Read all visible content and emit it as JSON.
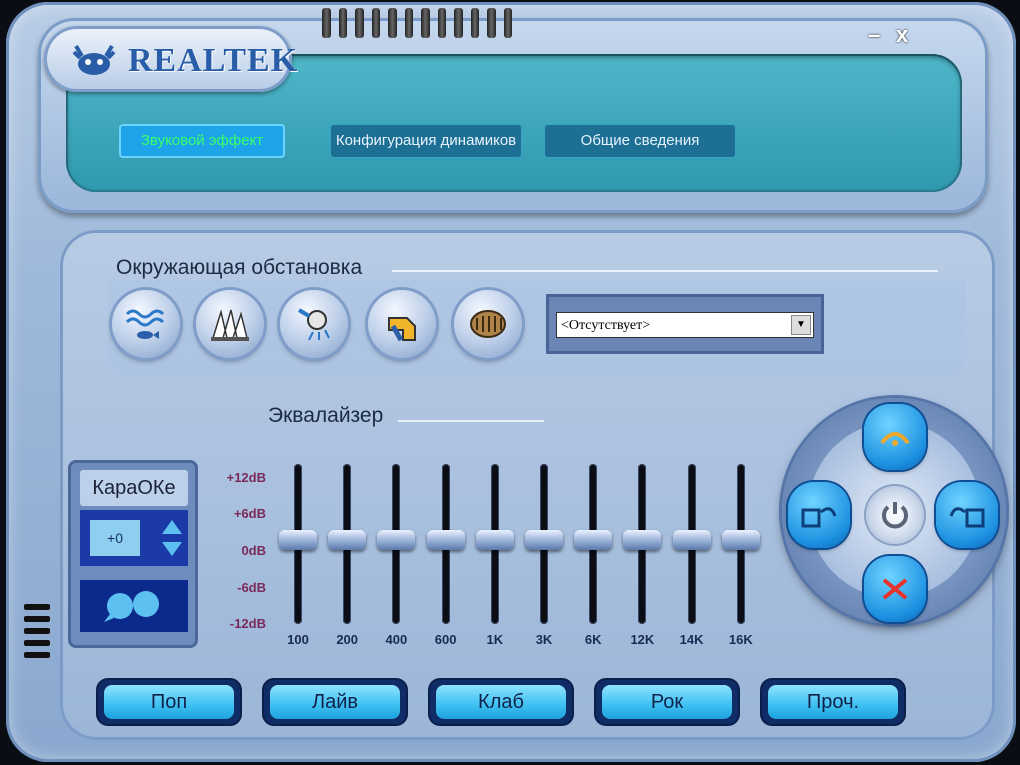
{
  "app": {
    "brand": "REALTEK"
  },
  "window_controls": {
    "minimize": "–",
    "close": "x"
  },
  "tabs": [
    {
      "label": "Звуковой эффект",
      "active": true
    },
    {
      "label": "Конфигурация динамиков",
      "active": false
    },
    {
      "label": "Общие сведения",
      "active": false
    }
  ],
  "environment": {
    "title": "Окружающая обстановка",
    "icons": [
      "underwater-icon",
      "opera-house-icon",
      "bathroom-icon",
      "sewer-pipe-icon",
      "colosseum-icon"
    ],
    "select_value": "<Отсутствует>"
  },
  "equalizer": {
    "title": "Эквалайзер",
    "db_labels": [
      "+12dB",
      "+6dB",
      "0dB",
      "-6dB",
      "-12dB"
    ],
    "bands": [
      "100",
      "200",
      "400",
      "600",
      "1K",
      "3K",
      "6K",
      "12K",
      "14K",
      "16K"
    ],
    "band_levels_db": [
      0,
      0,
      0,
      0,
      0,
      0,
      0,
      0,
      0,
      0
    ]
  },
  "karaoke": {
    "title": "КараОКе",
    "value": "+0"
  },
  "presets": [
    "Поп",
    "Лайв",
    "Клаб",
    "Рок",
    "Проч."
  ],
  "nav": {
    "buttons": [
      "load-icon",
      "open-icon",
      "save-icon",
      "reset-icon",
      "power-icon"
    ]
  },
  "colors": {
    "active_tab_text": "#39ff6a",
    "screen": "#3aa8bd",
    "accent": "#1ea4e8"
  }
}
